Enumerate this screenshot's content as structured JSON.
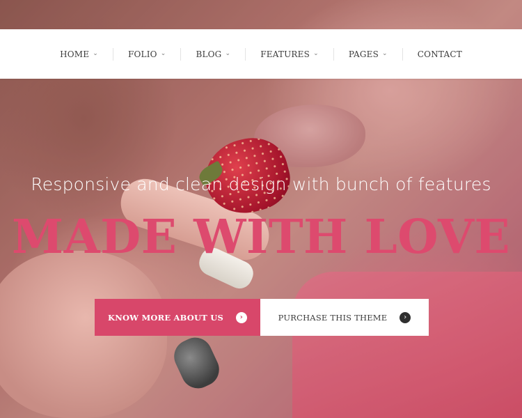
{
  "nav": {
    "items": [
      {
        "label": "HOME",
        "has_dropdown": true
      },
      {
        "label": "FOLIO",
        "has_dropdown": true
      },
      {
        "label": "BLOG",
        "has_dropdown": true
      },
      {
        "label": "FEATURES",
        "has_dropdown": true
      },
      {
        "label": "PAGES",
        "has_dropdown": true
      },
      {
        "label": "CONTACT",
        "has_dropdown": false
      }
    ]
  },
  "hero": {
    "subtitle": "Responsive and clean design with bunch of features",
    "headline": "MADE WITH LOVE",
    "primary_button": "KNOW MORE ABOUT US",
    "secondary_button": "PURCHASE THIS THEME",
    "accent_color": "#dd4a6e"
  },
  "icons": {
    "dropdown": "chevron-down-icon",
    "arrow": "arrow-right-circle-icon"
  }
}
